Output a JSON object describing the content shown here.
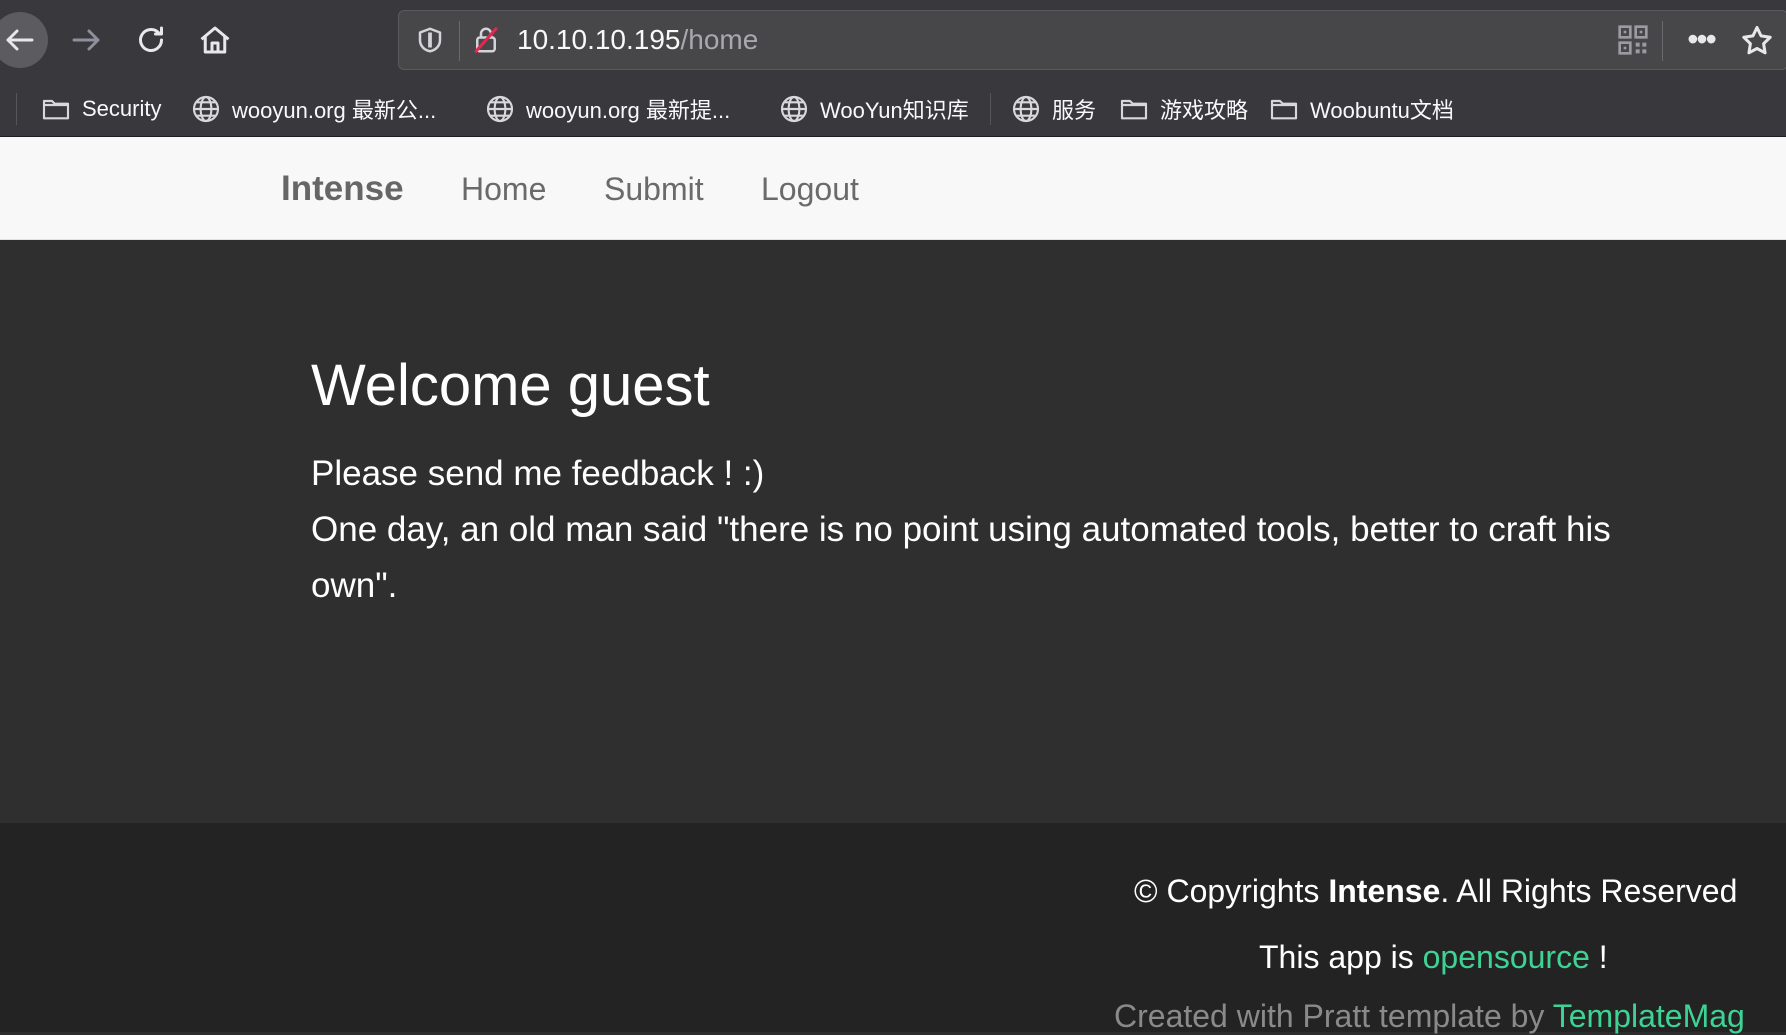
{
  "browser": {
    "url_host": "10.10.10.195",
    "url_path": "/home",
    "bookmarks": [
      {
        "label": "Security",
        "icon": "folder-icon"
      },
      {
        "label": "wooyun.org 最新公...",
        "icon": "globe-icon"
      },
      {
        "label": "wooyun.org 最新提...",
        "icon": "globe-icon"
      },
      {
        "label": "WooYun知识库",
        "icon": "globe-icon"
      },
      {
        "label": "服务",
        "icon": "globe-icon"
      },
      {
        "label": "游戏攻略",
        "icon": "folder-icon"
      },
      {
        "label": "Woobuntu文档",
        "icon": "folder-icon"
      }
    ]
  },
  "site": {
    "brand": "Intense",
    "nav": [
      "Home",
      "Submit",
      "Logout"
    ]
  },
  "main": {
    "title": "Welcome guest",
    "line1": "Please send me feedback ! :)",
    "line2": "One day, an old man said \"there is no point using automated tools, better to craft his own\"."
  },
  "footer": {
    "copyright_prefix": "© Copyrights ",
    "copyright_brand": "Intense",
    "copyright_suffix": ". All Rights Reserved",
    "opensource_prefix": "This app is ",
    "opensource_link": "opensource",
    "opensource_suffix": " !",
    "credit_prefix": "Created with Pratt template by ",
    "credit_link": "TemplateMag"
  },
  "colors": {
    "link_green": "#3ed394",
    "main_bg": "#2f2f2f",
    "footer_bg": "#232323",
    "navbar_bg": "#f8f8f8"
  }
}
